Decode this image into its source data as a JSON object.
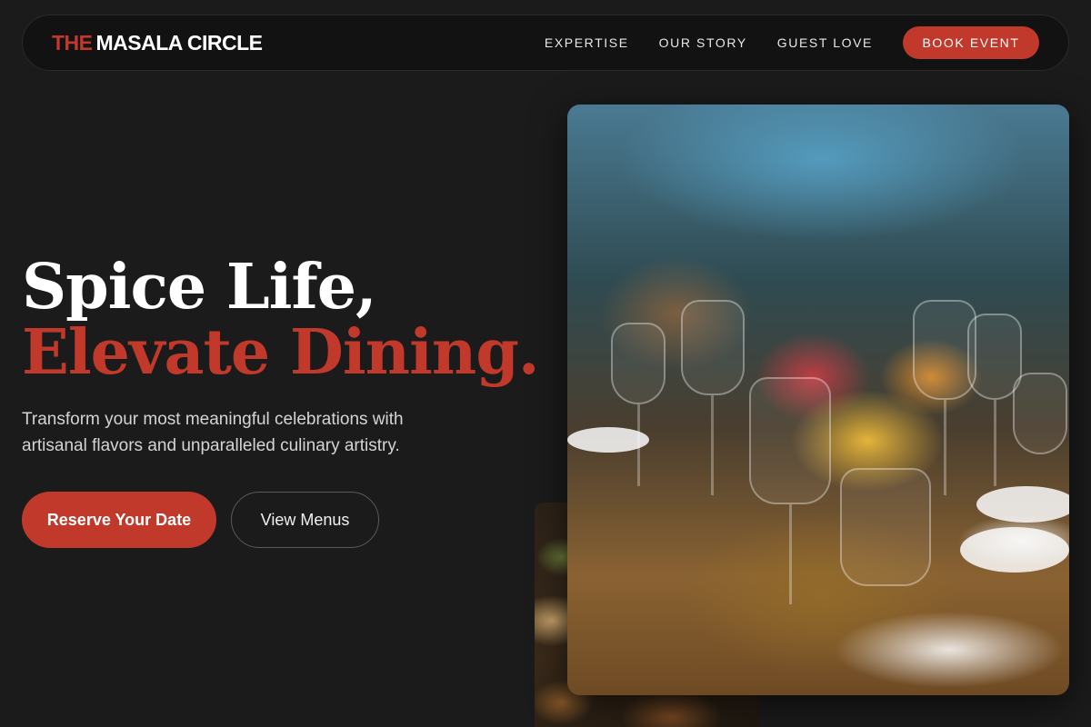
{
  "brand": {
    "accent": "THE",
    "name": "MASALA CIRCLE"
  },
  "nav": {
    "links": [
      "EXPERTISE",
      "OUR STORY",
      "GUEST LOVE"
    ],
    "cta": "BOOK EVENT"
  },
  "hero": {
    "title_line1": "Spice Life,",
    "title_line2": "Elevate Dining.",
    "subtitle": "Transform your most meaningful celebrations with artisanal flavors and unparalleled culinary artistry.",
    "primary_cta": "Reserve Your Date",
    "secondary_cta": "View Menus"
  },
  "colors": {
    "accent": "#c0392b",
    "background": "#1b1b1b",
    "nav_background": "#121212"
  }
}
